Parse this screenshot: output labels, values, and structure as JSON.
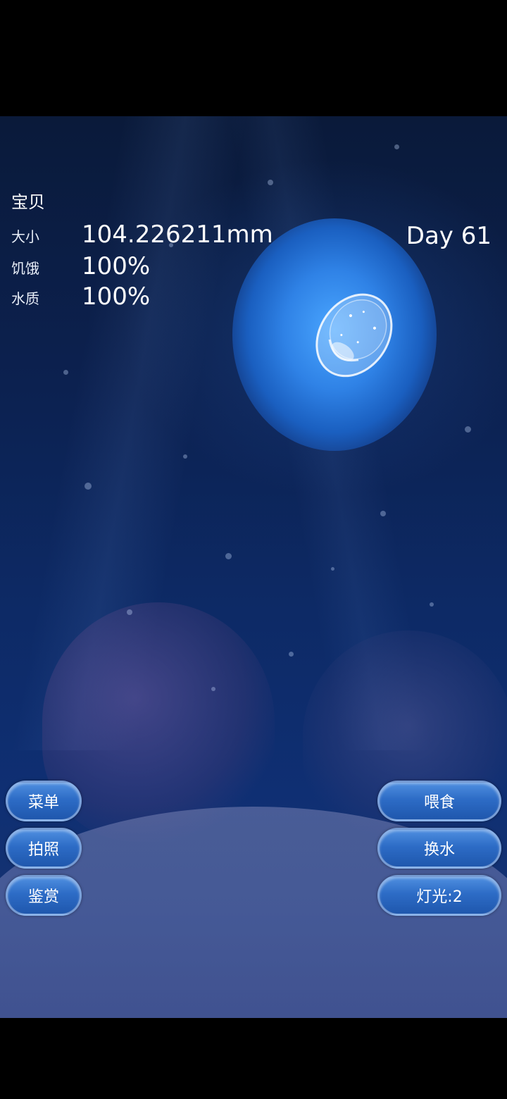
{
  "hud": {
    "title": "宝贝",
    "size_label": "大小",
    "size_value": "104.226211mm",
    "hunger_label": "饥饿",
    "hunger_value": "100%",
    "water_label": "水质",
    "water_value": "100%",
    "day": "Day 61"
  },
  "buttons": {
    "menu": "菜单",
    "photo": "拍照",
    "appreciate": "鉴赏",
    "feed": "喂食",
    "change_water": "换水",
    "light": "灯光:2"
  }
}
